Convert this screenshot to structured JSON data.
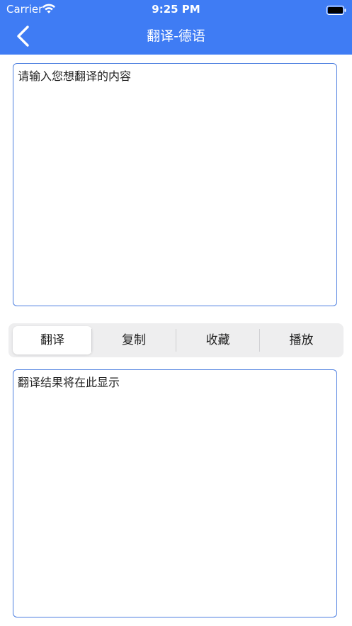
{
  "status_bar": {
    "carrier": "Carrier",
    "time": "9:25 PM"
  },
  "nav": {
    "title": "翻译-德语"
  },
  "input": {
    "placeholder": "请输入您想翻译的内容"
  },
  "actions": {
    "translate": "翻译",
    "copy": "复制",
    "favorite": "收藏",
    "play": "播放",
    "selected": "翻译"
  },
  "output": {
    "text": "翻译结果将在此显示"
  },
  "colors": {
    "header_bg": "#3f7cf4",
    "box_border": "#4d7fe0",
    "segment_bg": "#eeeeef"
  },
  "icons": {
    "back": "chevron-left-icon",
    "wifi": "wifi-icon",
    "battery": "battery-icon"
  }
}
